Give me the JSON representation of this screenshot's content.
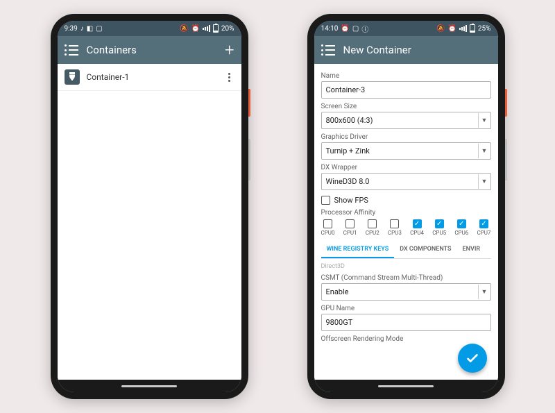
{
  "left": {
    "status": {
      "time": "9:39",
      "battery_pct": "20%"
    },
    "appbar": {
      "title": "Containers"
    },
    "list": {
      "items": [
        {
          "label": "Container-1"
        }
      ]
    }
  },
  "right": {
    "status": {
      "time": "14:10",
      "battery_pct": "25%"
    },
    "appbar": {
      "title": "New Container"
    },
    "form": {
      "name_label": "Name",
      "name_value": "Container-3",
      "screen_label": "Screen Size",
      "screen_value": "800x600 (4:3)",
      "driver_label": "Graphics Driver",
      "driver_value": "Turnip + Zink",
      "dxwrapper_label": "DX Wrapper",
      "dxwrapper_value": "WineD3D 8.0",
      "show_fps_label": "Show FPS",
      "show_fps_checked": false,
      "proc_affinity_label": "Processor Affinity",
      "cpus": [
        {
          "label": "CPU0",
          "checked": false
        },
        {
          "label": "CPU1",
          "checked": false
        },
        {
          "label": "CPU2",
          "checked": false
        },
        {
          "label": "CPU3",
          "checked": false
        },
        {
          "label": "CPU4",
          "checked": true
        },
        {
          "label": "CPU5",
          "checked": true
        },
        {
          "label": "CPU6",
          "checked": true
        },
        {
          "label": "CPU7",
          "checked": true
        }
      ],
      "tabs": [
        {
          "label": "WINE REGISTRY KEYS",
          "active": true
        },
        {
          "label": "DX COMPONENTS",
          "active": false
        },
        {
          "label": "ENVIR",
          "active": false
        }
      ],
      "d3d_section": "Direct3D",
      "csmt_label": "CSMT (Command Stream Multi-Thread)",
      "csmt_value": "Enable",
      "gpu_label": "GPU Name",
      "gpu_value": "9800GT",
      "offscreen_label": "Offscreen Rendering Mode"
    }
  }
}
